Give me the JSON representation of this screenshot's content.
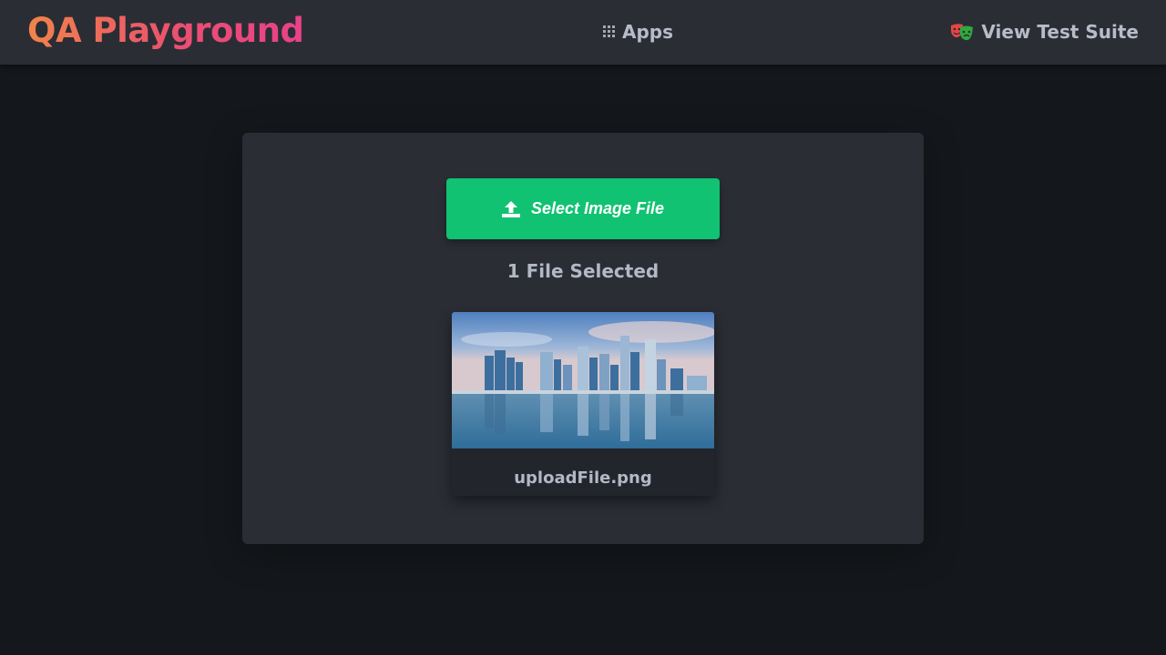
{
  "navbar": {
    "brand": "QA Playground",
    "apps_label": "Apps",
    "apps_icon": "grid-icon",
    "suite_label": "View Test Suite",
    "suite_icon": "theater-masks-icon"
  },
  "upload": {
    "button_label": "Select Image File",
    "button_icon": "upload-icon",
    "status_text": "1 File Selected",
    "file_name": "uploadFile.png"
  },
  "colors": {
    "background": "#14171b",
    "panel": "#2a2d34",
    "accent_green": "#10c271",
    "brand_gradient_start": "#f0844a",
    "brand_gradient_end": "#e8418a",
    "text_muted": "#b8bcc9"
  }
}
